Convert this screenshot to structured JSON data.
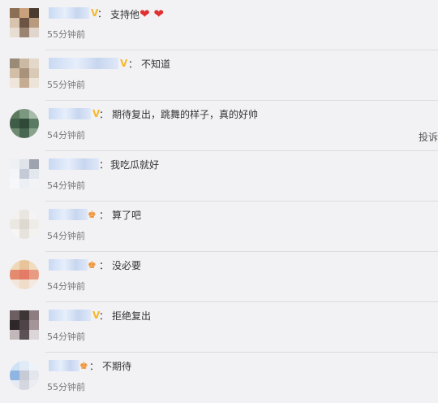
{
  "comments": [
    {
      "content": "支持他",
      "hearts": "❤ ❤",
      "time": "55分钟前",
      "badge": "V"
    },
    {
      "content": "不知道",
      "time": "55分钟前",
      "badge": "V"
    },
    {
      "content": "期待复出，跳舞的样子，真的好帅",
      "time": "54分钟前",
      "badge": "V",
      "report": "投诉"
    },
    {
      "content": "我吃瓜就好",
      "time": "54分钟前"
    },
    {
      "content": "算了吧",
      "time": "54分钟前",
      "badge": "♚"
    },
    {
      "content": "没必要",
      "time": "54分钟前",
      "badge": "♚"
    },
    {
      "content": "拒绝复出",
      "time": "54分钟前",
      "badge": "V"
    },
    {
      "content": "不期待",
      "time": "55分钟前",
      "badge": "♚"
    }
  ],
  "colon": "："
}
